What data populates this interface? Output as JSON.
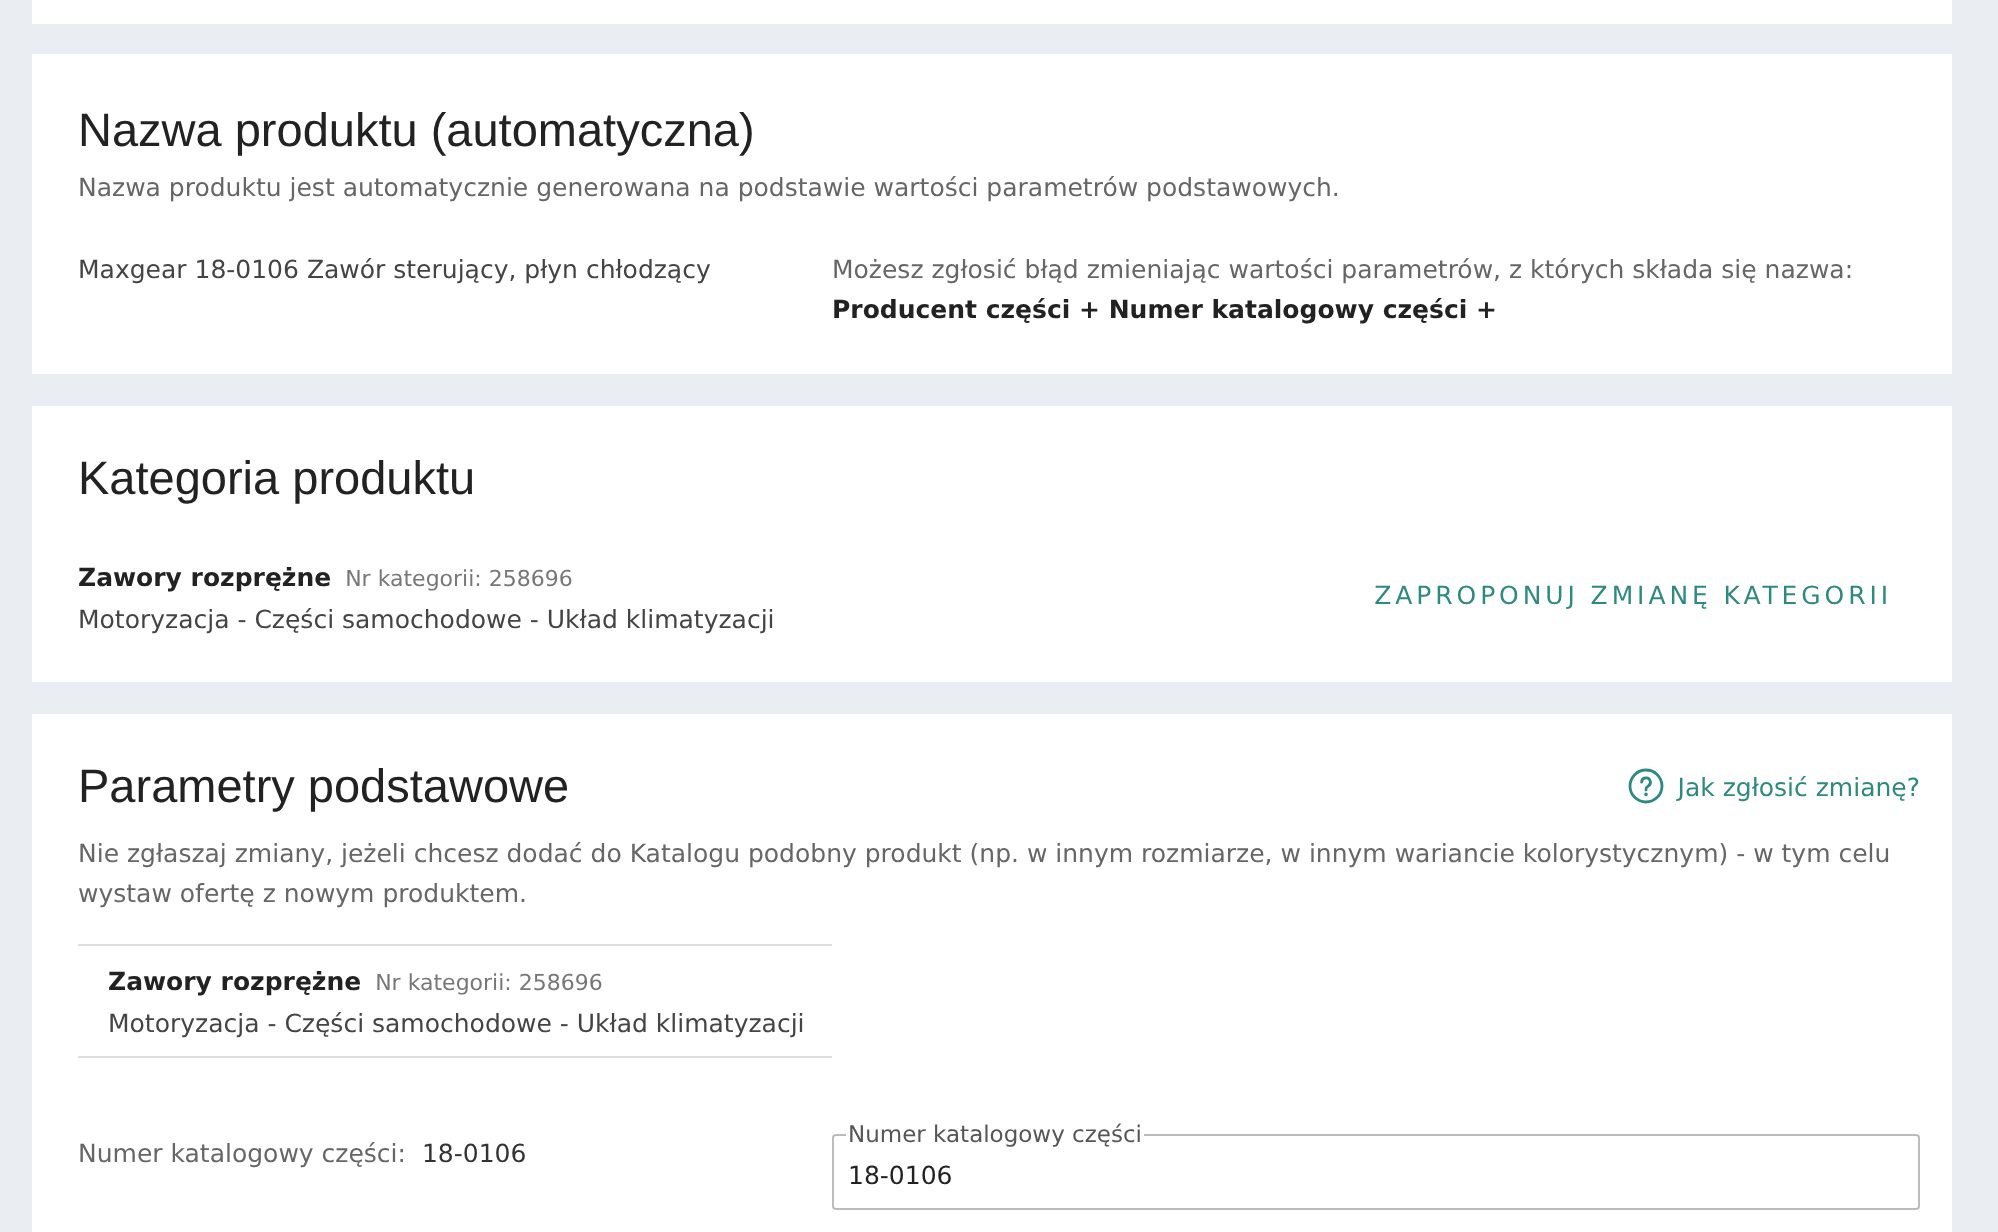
{
  "name_section": {
    "title": "Nazwa produktu (automatyczna)",
    "description": "Nazwa produktu jest automatycznie generowana na podstawie wartości parametrów podstawowych.",
    "product_name": "Maxgear 18-0106 Zawór sterujący, płyn chłodzący",
    "hint": "Możesz zgłosić błąd zmieniając wartości parametrów, z których składa się nazwa:",
    "name_formula": "Producent części + Numer katalogowy części +"
  },
  "category_section": {
    "title": "Kategoria produktu",
    "category": {
      "name": "Zawory rozprężne",
      "number": "Nr kategorii: 258696",
      "path": "Motoryzacja - Części samochodowe - Układ klimatyzacji"
    },
    "change_button": "ZAPROPONUJ ZMIANĘ KATEGORII"
  },
  "parameters_section": {
    "title": "Parametry podstawowe",
    "help_link": "Jak zgłosić zmianę?",
    "description": "Nie zgłaszaj zmiany, jeżeli chcesz dodać do Katalogu podobny produkt (np. w innym rozmiarze, w innym wariancie kolorystycznym) - w tym celu wystaw ofertę z nowym produktem.",
    "category": {
      "name": "Zawory rozprężne",
      "number": "Nr kategorii: 258696",
      "path": "Motoryzacja - Części samochodowe - Układ klimatyzacji"
    },
    "fields": [
      {
        "label": "Numer katalogowy części:",
        "value": "18-0106",
        "input_label": "Numer katalogowy części",
        "input_value": "18-0106"
      }
    ]
  }
}
